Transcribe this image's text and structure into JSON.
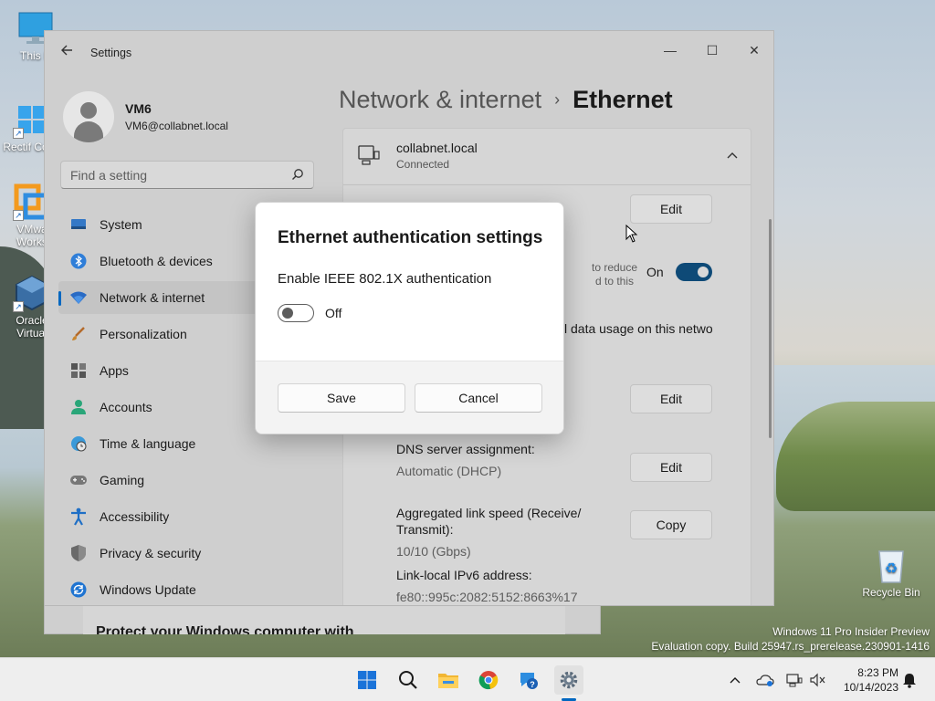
{
  "desktop": {
    "icons": [
      {
        "label": "This P"
      },
      {
        "label": "Rectif Contr"
      },
      {
        "label": "VMwa Works"
      },
      {
        "label": "Oracle Virtual"
      },
      {
        "label": "Recycle Bin"
      }
    ],
    "watermark_line1": "Windows 11 Pro Insider Preview",
    "watermark_line2": "Evaluation copy. Build 25947.rs_prerelease.230901-1416"
  },
  "window": {
    "app_title": "Settings",
    "back_icon": "back-arrow-icon",
    "minimize": "—",
    "maximize": "☐",
    "close": "✕"
  },
  "profile": {
    "name": "VM6",
    "email": "VM6@collabnet.local"
  },
  "search": {
    "placeholder": "Find a setting"
  },
  "nav": {
    "items": [
      {
        "label": "System",
        "icon": "monitor-icon"
      },
      {
        "label": "Bluetooth & devices",
        "icon": "bluetooth-icon"
      },
      {
        "label": "Network & internet",
        "icon": "wifi-icon",
        "active": true
      },
      {
        "label": "Personalization",
        "icon": "brush-icon"
      },
      {
        "label": "Apps",
        "icon": "apps-icon"
      },
      {
        "label": "Accounts",
        "icon": "person-icon"
      },
      {
        "label": "Time & language",
        "icon": "globe-clock-icon"
      },
      {
        "label": "Gaming",
        "icon": "gamepad-icon"
      },
      {
        "label": "Accessibility",
        "icon": "accessibility-icon"
      },
      {
        "label": "Privacy & security",
        "icon": "shield-icon"
      },
      {
        "label": "Windows Update",
        "icon": "update-icon"
      }
    ]
  },
  "content": {
    "breadcrumb_parent": "Network & internet",
    "breadcrumb_sep": "›",
    "breadcrumb_current": "Ethernet",
    "connection_name": "collabnet.local",
    "connection_status": "Connected",
    "edit_label": "Edit",
    "metered_partial_1": "to reduce",
    "metered_partial_2": "d to this",
    "metered_state": "On",
    "data_usage_partial": "l data usage on this netwo",
    "dns_label": "DNS server assignment:",
    "dns_value": "Automatic (DHCP)",
    "link_speed_label": "Aggregated link speed (Receive/ Transmit):",
    "link_speed_value": "10/10 (Gbps)",
    "copy_label": "Copy",
    "ipv6_label": "Link-local IPv6 address:",
    "ipv6_value": "fe80::995c:2082:5152:8663%17"
  },
  "bottom_window": {
    "text": "Protect your Windows computer with"
  },
  "dialog": {
    "title": "Ethernet authentication settings",
    "option_label": "Enable IEEE 802.1X authentication",
    "toggle_state": "Off",
    "save_label": "Save",
    "cancel_label": "Cancel"
  },
  "taskbar": {
    "apps": [
      "start-icon",
      "search-icon",
      "file-explorer-icon",
      "chrome-icon",
      "help-icon",
      "settings-icon"
    ],
    "time": "8:23 PM",
    "date": "10/14/2023"
  }
}
